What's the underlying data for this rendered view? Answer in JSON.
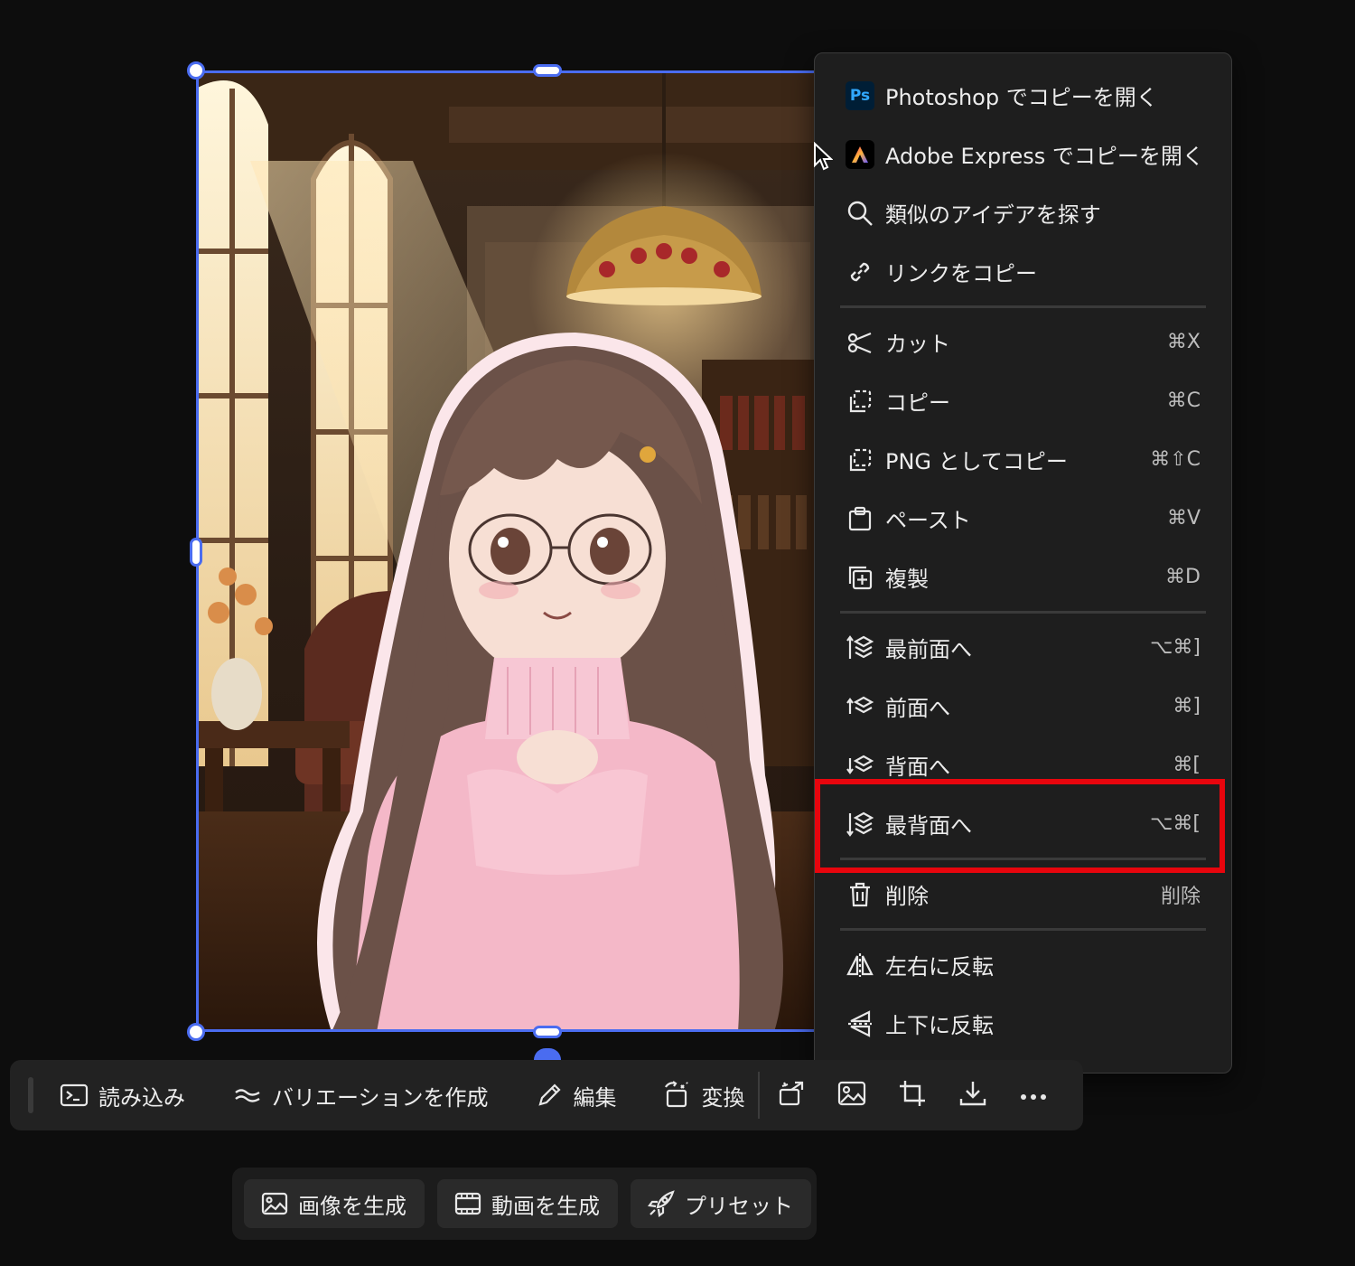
{
  "colors": {
    "selection": "#4a6cf0",
    "highlight": "#e8050d",
    "menu_bg": "#1e1e1e",
    "toolbar_bg": "#222222"
  },
  "canvas": {
    "image_subject": "anime-girl-pink-sweater-library-room"
  },
  "context_menu": {
    "items": [
      {
        "icon": "photoshop-icon",
        "label": "Photoshop でコピーを開く",
        "shortcut": ""
      },
      {
        "icon": "adobe-express-icon",
        "label": "Adobe Express でコピーを開く",
        "shortcut": ""
      },
      {
        "icon": "search-icon",
        "label": "類似のアイデアを探す",
        "shortcut": ""
      },
      {
        "icon": "link-icon",
        "label": "リンクをコピー",
        "shortcut": ""
      },
      {
        "icon": "scissors-icon",
        "label": "カット",
        "shortcut": "⌘X"
      },
      {
        "icon": "copy-icon",
        "label": "コピー",
        "shortcut": "⌘C"
      },
      {
        "icon": "copy-png-icon",
        "label": "PNG としてコピー",
        "shortcut": "⌘⇧C"
      },
      {
        "icon": "paste-icon",
        "label": "ペースト",
        "shortcut": "⌘V"
      },
      {
        "icon": "duplicate-icon",
        "label": "複製",
        "shortcut": "⌘D"
      },
      {
        "icon": "bring-to-front-icon",
        "label": "最前面へ",
        "shortcut": "⌥⌘]"
      },
      {
        "icon": "bring-forward-icon",
        "label": "前面へ",
        "shortcut": "⌘]"
      },
      {
        "icon": "send-backward-icon",
        "label": "背面へ",
        "shortcut": "⌘["
      },
      {
        "icon": "send-to-back-icon",
        "label": "最背面へ",
        "shortcut": "⌥⌘["
      },
      {
        "icon": "trash-icon",
        "label": "削除",
        "shortcut": "削除"
      },
      {
        "icon": "flip-horizontal-icon",
        "label": "左右に反転",
        "shortcut": ""
      },
      {
        "icon": "flip-vertical-icon",
        "label": "上下に反転",
        "shortcut": ""
      }
    ]
  },
  "toolbar": {
    "import_label": "読み込み",
    "variation_label": "バリエーションを作成",
    "edit_label": "編集",
    "convert_label": "変換",
    "icon_buttons": [
      "magic-expand-icon",
      "image-icon",
      "crop-icon",
      "download-icon",
      "more-icon"
    ]
  },
  "generate_bar": {
    "image_label": "画像を生成",
    "video_label": "動画を生成",
    "preset_label": "プリセット"
  }
}
